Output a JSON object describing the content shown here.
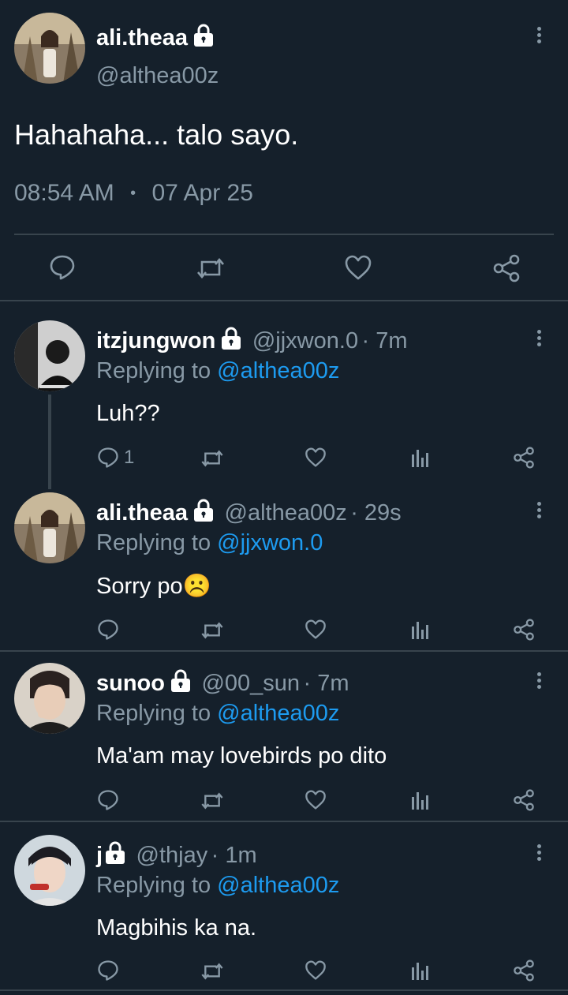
{
  "main_tweet": {
    "display_name": "ali.theaa",
    "handle": "@althea00z",
    "text": "Hahahaha... talo sayo.",
    "time": "08:54 AM",
    "separator": "•",
    "date": "07 Apr 25",
    "actions": [
      "reply-icon",
      "retweet-icon",
      "like-icon",
      "share-icon"
    ]
  },
  "replies": [
    {
      "display_name": "itzjungwon",
      "handle": "@jjxwon.0",
      "time": "· 7m",
      "replying_prefix": "Replying to",
      "replying_to": "@althea00z",
      "text": "Luh??",
      "reply_count": "1"
    },
    {
      "display_name": "ali.theaa",
      "handle": "@althea00z",
      "time": "· 29s",
      "replying_prefix": "Replying to",
      "replying_to": "@jjxwon.0",
      "text": "Sorry po☹️"
    },
    {
      "display_name": "sunoo",
      "handle": "@00_sun",
      "time": "· 7m",
      "replying_prefix": "Replying to",
      "replying_to": "@althea00z",
      "text": "Ma'am may lovebirds po dito"
    },
    {
      "display_name": "j",
      "handle": "@thjay",
      "time": "· 1m",
      "replying_prefix": "Replying to",
      "replying_to": "@althea00z",
      "text": "Magbihis ka na."
    }
  ],
  "colors": {
    "background": "#15202b",
    "muted": "#8899a6",
    "link": "#1d9bf0",
    "divider": "#38444d"
  }
}
